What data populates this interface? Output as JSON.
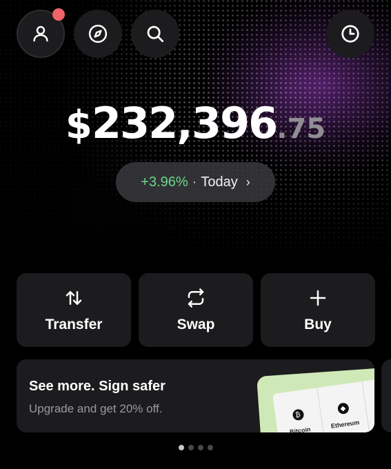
{
  "header": {
    "profile_icon": "person-icon",
    "explore_icon": "compass-icon",
    "search_icon": "search-icon",
    "history_icon": "clock-icon",
    "notification_color": "#f0636b"
  },
  "balance": {
    "currency": "$",
    "integer": "232,396",
    "decimal": ".75"
  },
  "change": {
    "percent": "+3.96%",
    "separator": "·",
    "period": "Today",
    "chevron": "›",
    "positive_color": "#6cd98a"
  },
  "actions": [
    {
      "label": "Transfer",
      "icon": "arrows-up-down-icon"
    },
    {
      "label": "Swap",
      "icon": "repeat-icon"
    },
    {
      "label": "Buy",
      "icon": "plus-icon"
    }
  ],
  "promo": {
    "title": "See more. Sign safer",
    "subtitle": "Upgrade and get 20% off.",
    "device_coins": [
      {
        "name": "Bitcoin",
        "symbol": "₿"
      },
      {
        "name": "Ethereum",
        "symbol": "◆"
      }
    ]
  },
  "pagination": {
    "total": 4,
    "active": 1
  }
}
